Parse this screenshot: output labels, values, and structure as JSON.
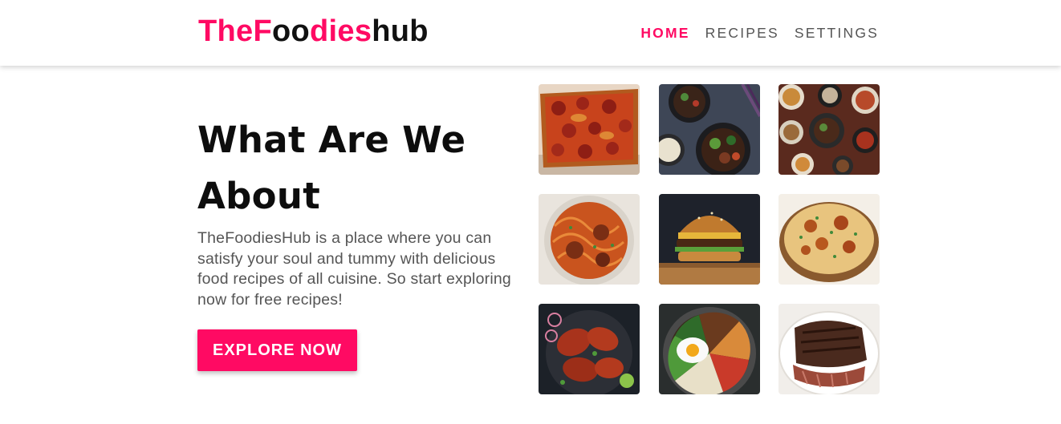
{
  "navbar": {
    "logo": {
      "part1": "The",
      "part2": "F",
      "part3": "oo",
      "part4": "dies",
      "part5": "hub"
    },
    "links": [
      {
        "label": "HOME",
        "active": true
      },
      {
        "label": "RECIPES",
        "active": false
      },
      {
        "label": "SETTINGS",
        "active": false
      }
    ]
  },
  "hero": {
    "title": "What Are We About",
    "description": "TheFoodiesHub is a place where you can satisfy your soul and tummy with delicious food recipes of all cuisine. So start exploring now for free recipes!",
    "button_label": "EXPLORE NOW"
  },
  "colors": {
    "accent": "#ff0a63",
    "text_dark": "#0d0d0d",
    "text_muted": "#555555"
  },
  "gallery": [
    {
      "icon": "pizza-image"
    },
    {
      "icon": "rice-bowl-image"
    },
    {
      "icon": "asian-spread-image"
    },
    {
      "icon": "spaghetti-meatballs-image"
    },
    {
      "icon": "burger-image"
    },
    {
      "icon": "biryani-image"
    },
    {
      "icon": "tandoori-chicken-image"
    },
    {
      "icon": "bibimbap-image"
    },
    {
      "icon": "steak-image"
    }
  ]
}
